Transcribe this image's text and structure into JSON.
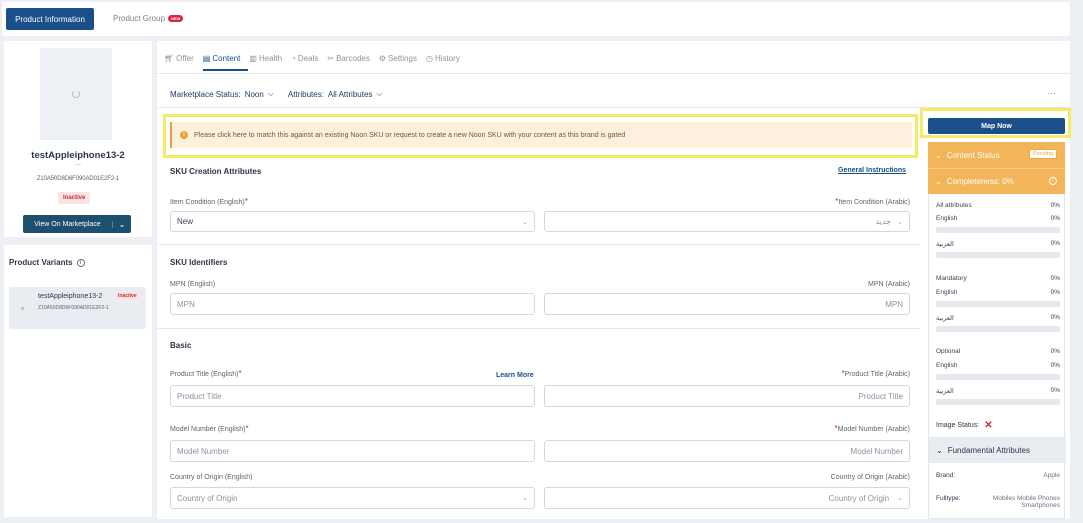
{
  "header": {
    "tab_product_info": "Product Information",
    "tab_product_group": "Product Group",
    "new_badge": "NEW"
  },
  "product": {
    "name": "testAppleiphone13-2",
    "dash": "---",
    "sku": "Z10A50D8D6F090AD01E2F2-1",
    "status": "Inactive",
    "view_marketplace": "View On Marketplace"
  },
  "variants": {
    "title": "Product Variants",
    "items": [
      {
        "name": "testAppleiphone13-2",
        "status": "Inactive",
        "sku": "Z10A50D8D6F090AD01E2F2-1"
      }
    ]
  },
  "tabs": [
    {
      "label": "Offer",
      "icon": "cart-icon",
      "active": false
    },
    {
      "label": "Content",
      "icon": "content-icon",
      "active": true
    },
    {
      "label": "Health",
      "icon": "health-icon",
      "active": false
    },
    {
      "label": "Deals",
      "icon": "deals-icon",
      "active": false
    },
    {
      "label": "Barcodes",
      "icon": "barcode-icon",
      "active": false
    },
    {
      "label": "Settings",
      "icon": "settings-icon",
      "active": false
    },
    {
      "label": "History",
      "icon": "history-icon",
      "active": false
    }
  ],
  "filters": {
    "marketplace_label": "Marketplace Status:",
    "marketplace_value": "Noon",
    "attributes_label": "Attributes:",
    "attributes_value": "All Attributes",
    "more": "···"
  },
  "alert": {
    "text": "Please click here to match this against an existing Noon SKU or request to create a new Noon SKU with your content as this brand is gated"
  },
  "form": {
    "sku_creation_title": "SKU Creation Attributes",
    "general_instructions": "General Instructions",
    "item_condition_en_label": "Item Condition (English)",
    "item_condition_ar_label": "Item Condition (Arabic)",
    "item_condition_en_value": "New",
    "item_condition_ar_value": "جديد",
    "sku_identifiers_title": "SKU Identifiers",
    "mpn_en_label": "MPN (English)",
    "mpn_ar_label": "MPN (Arabic)",
    "mpn_en_placeholder": "MPN",
    "mpn_ar_placeholder": "MPN",
    "basic_title": "Basic",
    "title_en_label": "Product Title (English)",
    "learn_more": "Learn More",
    "title_ar_label": "Product Title (Arabic)",
    "title_en_placeholder": "Product Title",
    "title_ar_placeholder": "Product Title",
    "model_en_label": "Model Number (English)",
    "model_ar_label": "Model Number (Arabic)",
    "model_en_placeholder": "Model Number",
    "model_ar_placeholder": "Model Number",
    "origin_en_label": "Country of Origin (English)",
    "origin_ar_label": "Country of Origin (Arabic)",
    "origin_en_placeholder": "Country of Origin",
    "origin_ar_placeholder": "Country of Origin"
  },
  "sidebar": {
    "map_now": "Map Now",
    "content_status": "Content Status",
    "pending": "Pending",
    "completeness": "Completeness: 0%",
    "stats": {
      "all_attributes": "All attributes",
      "all_pct": "0%",
      "english": "English",
      "english_pct": "0%",
      "arabic": "العربية",
      "arabic_pct": "0%",
      "mandatory": "Mandatory",
      "mandatory_pct": "0%",
      "m_english_pct": "0%",
      "m_arabic_pct": "0%",
      "optional": "Optional",
      "optional_pct": "0%",
      "o_english_pct": "0%",
      "o_arabic_pct": "0%"
    },
    "image_status": "Image Status:",
    "fundamental": "Fundamental Attributes",
    "brand_label": "Brand:",
    "brand_value": "Apple",
    "fulltype_label": "Fulltype:",
    "fulltype_value": "Mobiles Mobile Phones Smartphones"
  },
  "colors": {
    "primary": "#1a4f8a",
    "highlight": "#f4ea68",
    "orange": "#f3b55a",
    "danger": "#d7263d"
  }
}
